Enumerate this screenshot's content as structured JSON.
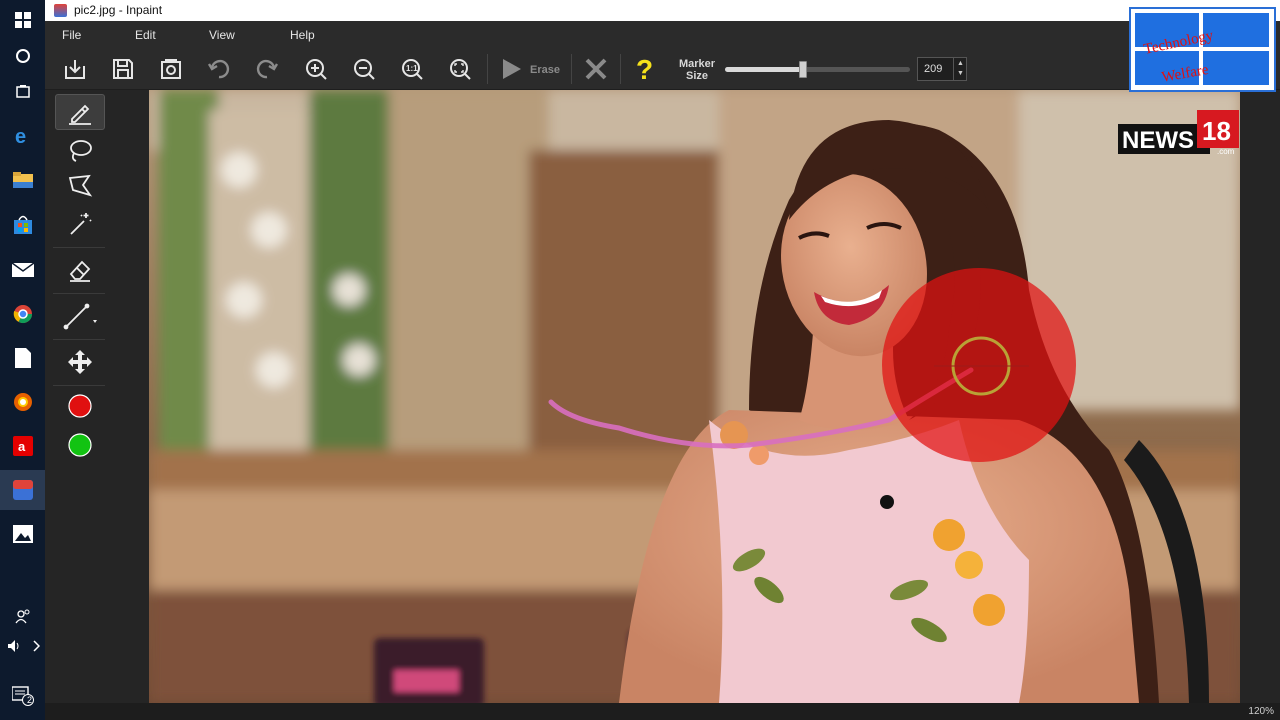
{
  "window": {
    "title": "pic2.jpg - Inpaint"
  },
  "menu": [
    "File",
    "Edit",
    "View",
    "Help"
  ],
  "toolbar": {
    "erase_label": "Erase",
    "marker_size_label": "Marker\nSize",
    "marker_size_value": "209",
    "marker_size_fraction": 0.42
  },
  "icons": {
    "open": "open-icon",
    "save": "save-icon",
    "save_as": "save-as-icon",
    "undo": "undo-icon",
    "redo": "redo-icon",
    "zoom_in": "zoom-in-icon",
    "zoom_out": "zoom-out-icon",
    "actual_size": "actual-size-icon",
    "fit": "fit-window-icon",
    "erase": "play-icon",
    "cancel": "close-icon",
    "help": "help-icon"
  },
  "tools": [
    {
      "name": "marker-tool",
      "selected": true
    },
    {
      "name": "lasso-tool"
    },
    {
      "name": "polygonal-lasso-tool"
    },
    {
      "name": "magic-wand-tool"
    },
    {
      "name": "eraser-tool"
    },
    {
      "name": "line-tool"
    },
    {
      "name": "move-tool"
    },
    {
      "name": "red-marker-color",
      "color": "#e01010"
    },
    {
      "name": "green-guide-color",
      "color": "#12c312"
    }
  ],
  "canvas": {
    "logo_text": "NEWS",
    "logo_number": "18",
    "logo_domain": ".com"
  },
  "status": {
    "zoom": "120%"
  },
  "watermark": {
    "line1": "Technology",
    "line2": "Welfare"
  },
  "taskbar": {
    "notification_count": "2",
    "items": [
      "windows-start-icon",
      "cortana-icon",
      "task-view-icon",
      "edge-icon",
      "file-explorer-icon",
      "store-icon",
      "mail-icon",
      "chrome-icon",
      "document-icon",
      "firefox-icon",
      "airtel-icon",
      "inpaint-icon",
      "photos-icon"
    ]
  },
  "colors": {
    "marker": "#e01010",
    "accent": "#2a6fd6"
  }
}
